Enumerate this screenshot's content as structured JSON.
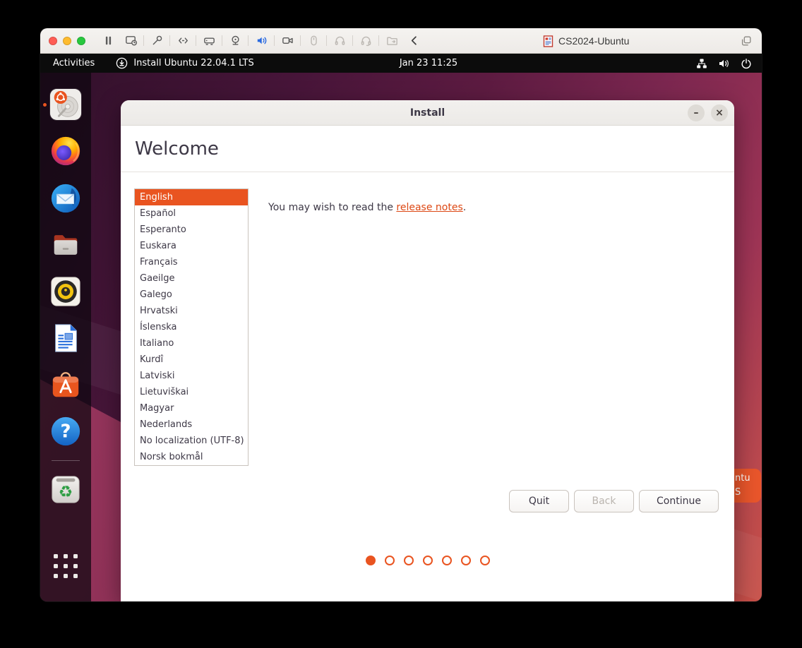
{
  "colors": {
    "accent": "#e95420",
    "link": "#dd4814",
    "selection_bg": "#e95420",
    "topbar_bg": "#0c0c0c",
    "mac_titlebar_bg": "#f0eeeb",
    "desktop_purple": "#471539",
    "desktop_red": "#c84f46"
  },
  "mac": {
    "title": "CS2024-Ubuntu",
    "toolbar_icons": [
      "pause",
      "display-restart",
      "wrench",
      "code",
      "drive",
      "webcam",
      "speaker",
      "video-camera",
      "mouse",
      "headphones",
      "headphones-alt",
      "shared-folder",
      "back-chevron",
      "duplicate"
    ]
  },
  "topbar": {
    "activities": "Activities",
    "app_title": "Install Ubuntu 22.04.1 LTS",
    "clock": "Jan 23  11:25",
    "status_icons": [
      "network",
      "volume",
      "power"
    ]
  },
  "dock": {
    "items": [
      "ubuntu-installer",
      "firefox",
      "thunderbird",
      "files",
      "rhythmbox",
      "libreoffice-writer",
      "ubuntu-software",
      "help",
      "trash",
      "app-grid"
    ]
  },
  "desktop_icon": {
    "visible_text_line1": "ntu",
    "visible_text_line2": "S"
  },
  "installer": {
    "title": "Install",
    "heading": "Welcome",
    "info": {
      "prefix": "You may wish to read the ",
      "link": "release notes",
      "suffix": "."
    },
    "languages": [
      "English",
      "Español",
      "Esperanto",
      "Euskara",
      "Français",
      "Gaeilge",
      "Galego",
      "Hrvatski",
      "Íslenska",
      "Italiano",
      "Kurdî",
      "Latviski",
      "Lietuviškai",
      "Magyar",
      "Nederlands",
      "No localization (UTF-8)",
      "Norsk bokmål"
    ],
    "selected_language": "English",
    "buttons": {
      "quit": "Quit",
      "back": "Back",
      "continue": "Continue"
    },
    "window_controls": {
      "minimize": "–",
      "close": "×"
    },
    "pager": {
      "total": 7,
      "current": 1
    }
  }
}
